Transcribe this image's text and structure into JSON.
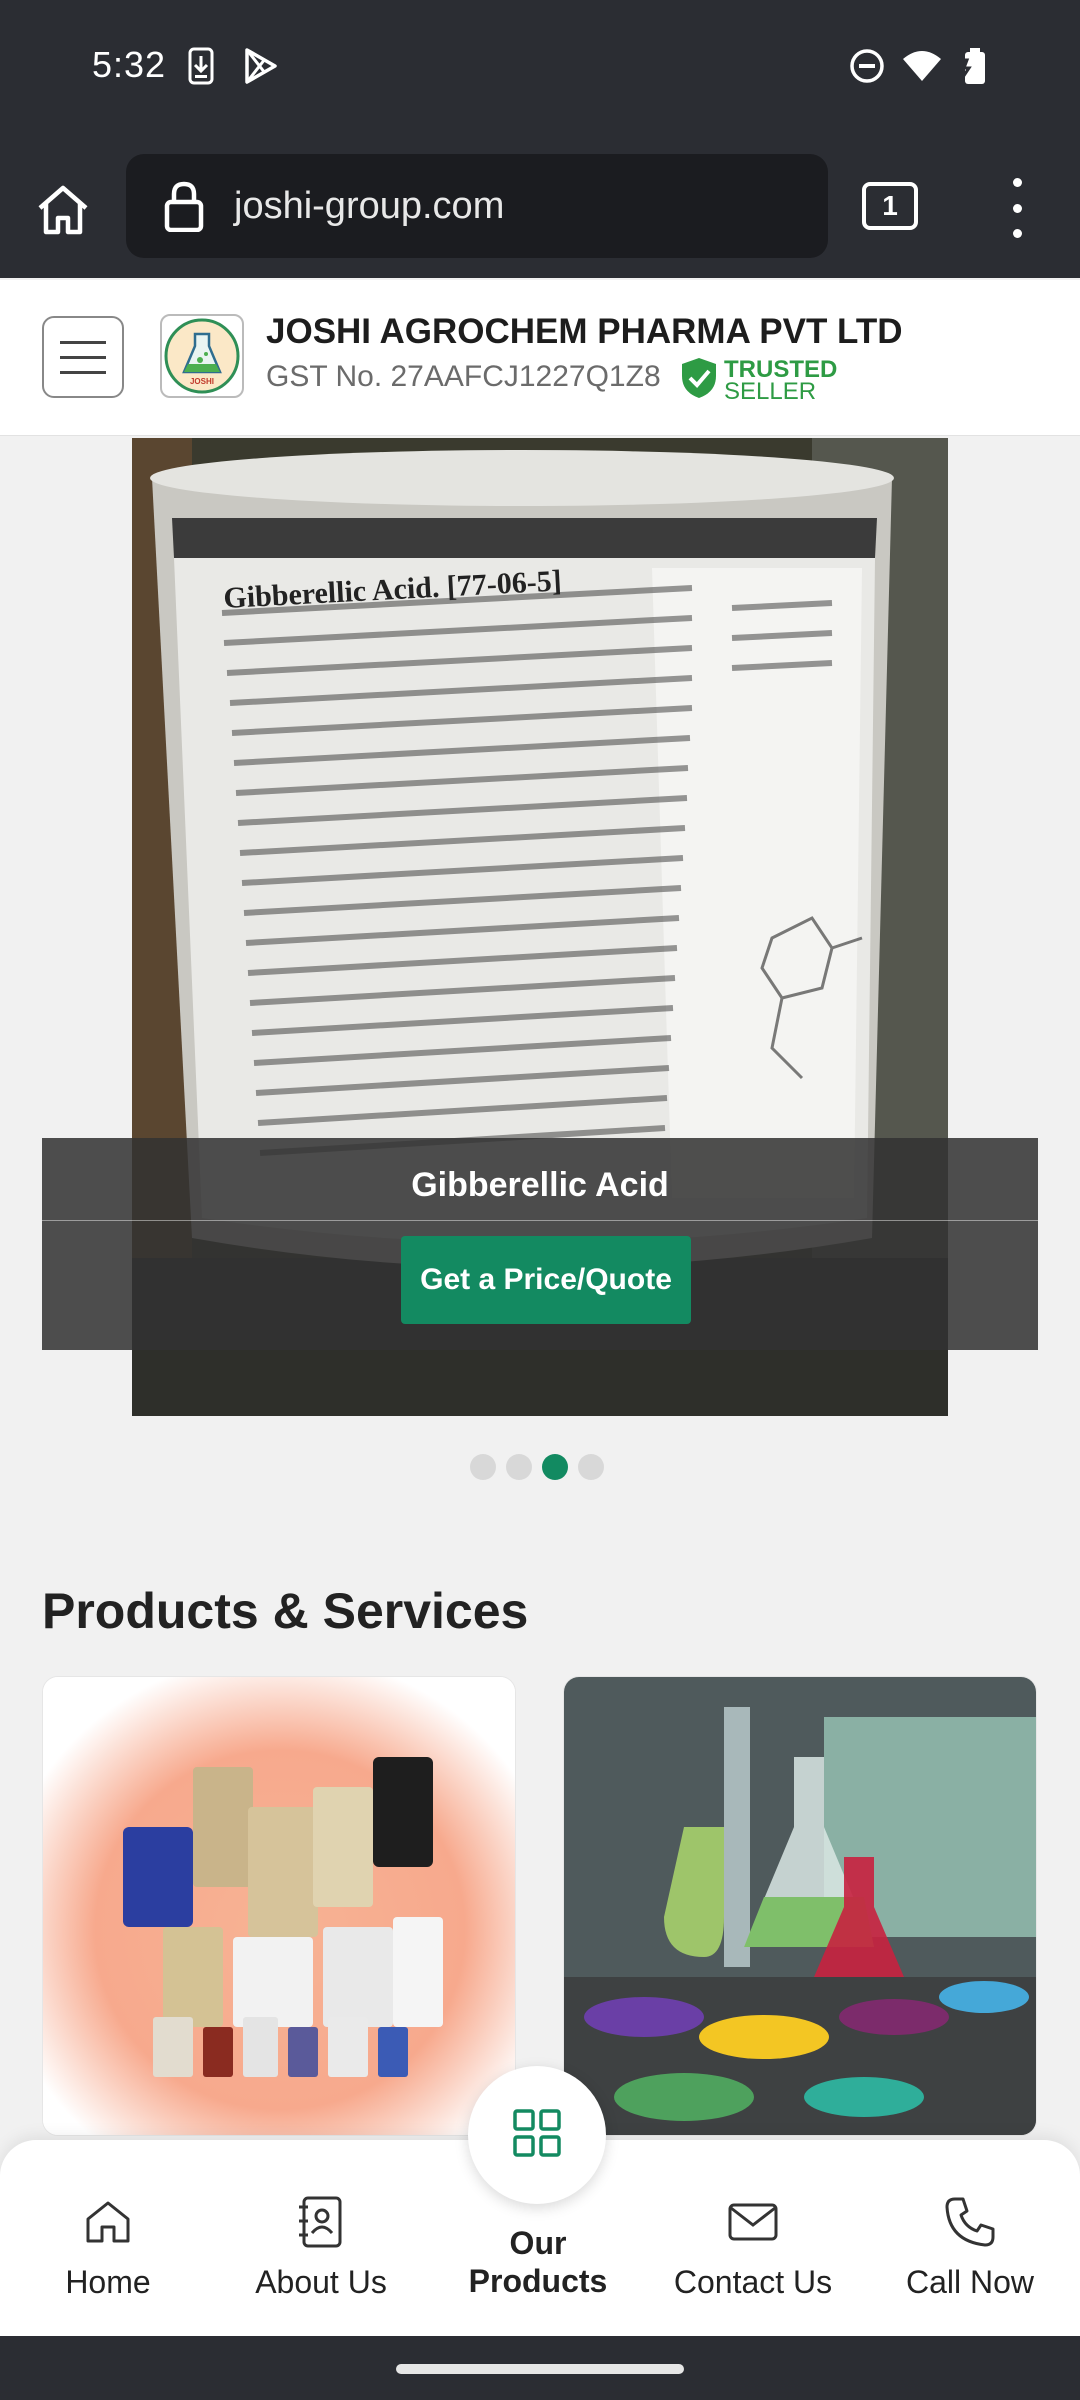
{
  "status_bar": {
    "time": "5:32",
    "left_icons": [
      "download-icon",
      "play-store-icon"
    ],
    "right_icons": [
      "do-not-disturb-icon",
      "wifi-icon",
      "battery-charging-icon"
    ]
  },
  "browser": {
    "url": "joshi-group.com",
    "tab_count": "1",
    "icons": [
      "home-icon",
      "lock-icon",
      "tabs-icon",
      "more-vert-icon"
    ]
  },
  "site_header": {
    "company_name": "JOSHI AGROCHEM PHARMA PVT LTD",
    "gst": "GST No. 27AAFCJ1227Q1Z8",
    "trusted_line1": "TRUSTED",
    "trusted_line2": "SELLER",
    "logo_text": "JOSHI"
  },
  "carousel": {
    "caption": "Gibberellic Acid",
    "button_label": "Get a Price/Quote",
    "slide_count": 4,
    "active_slide": 3,
    "label_heading": "Gibberellic Acid. [77-06-5]"
  },
  "products_section": {
    "title": "Products & Services"
  },
  "bottom_nav": {
    "home": "Home",
    "about": "About Us",
    "products_line1": "Our",
    "products_line2": "Products",
    "contact": "Contact Us",
    "call": "Call Now"
  },
  "colors": {
    "accent": "#138a61",
    "trusted_green": "#2e9b44",
    "chrome_dark": "#2b2d33"
  }
}
